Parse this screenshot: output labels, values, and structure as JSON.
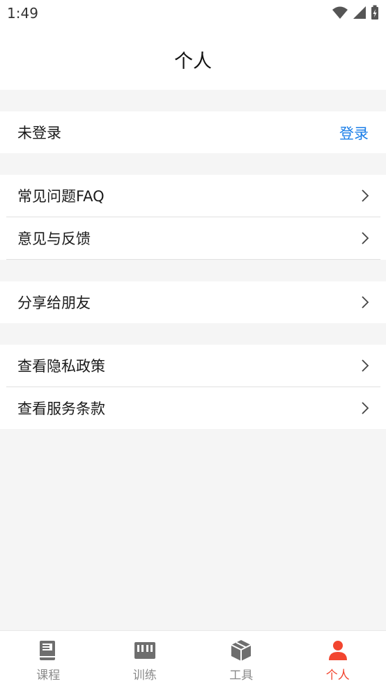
{
  "status_bar": {
    "time": "1:49"
  },
  "header": {
    "title": "个人"
  },
  "account": {
    "status_label": "未登录",
    "login_label": "登录"
  },
  "menu": {
    "faq_label": "常见问题FAQ",
    "feedback_label": "意见与反馈",
    "share_label": "分享给朋友",
    "privacy_label": "查看隐私政策",
    "terms_label": "查看服务条款"
  },
  "tabbar": {
    "tabs": [
      {
        "label": "课程",
        "icon": "book-icon"
      },
      {
        "label": "训练",
        "icon": "piano-icon"
      },
      {
        "label": "工具",
        "icon": "box-icon"
      },
      {
        "label": "个人",
        "icon": "person-icon"
      }
    ],
    "active_index": 3
  },
  "colors": {
    "accent": "#f2452f",
    "link": "#1a7ee8",
    "background": "#f5f5f5"
  }
}
